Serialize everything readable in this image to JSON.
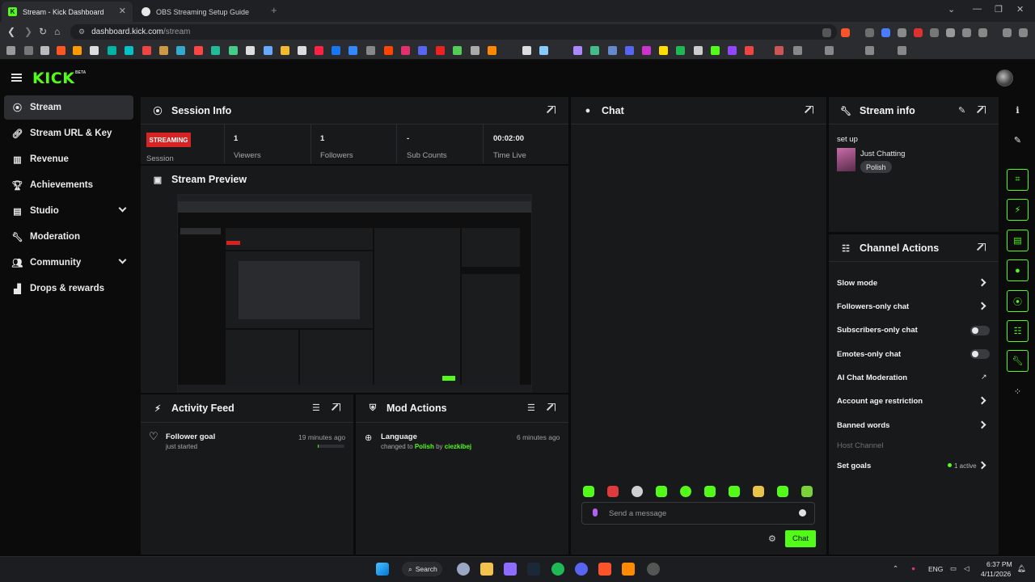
{
  "browser": {
    "tabs": [
      {
        "label": "Stream - Kick Dashboard",
        "active": true
      },
      {
        "label": "OBS Streaming Setup Guide",
        "active": false
      }
    ],
    "url_host": "dashboard.kick.com",
    "url_path": "/stream"
  },
  "app": {
    "logo": "KICK",
    "beta": "BETA"
  },
  "sidebar": {
    "items": [
      {
        "label": "Stream",
        "icon": "live-icon"
      },
      {
        "label": "Stream URL & Key",
        "icon": "link-icon"
      },
      {
        "label": "Revenue",
        "icon": "chart-icon"
      },
      {
        "label": "Achievements",
        "icon": "trophy-icon"
      },
      {
        "label": "Studio",
        "icon": "studio-icon"
      },
      {
        "label": "Moderation",
        "icon": "wrench-icon"
      },
      {
        "label": "Community",
        "icon": "people-icon"
      },
      {
        "label": "Drops & rewards",
        "icon": "gift-icon"
      }
    ]
  },
  "session": {
    "title": "Session Info",
    "status": "STREAMING",
    "status_label": "Session",
    "stats": [
      {
        "value": "1",
        "label": "Viewers"
      },
      {
        "value": "1",
        "label": "Followers"
      },
      {
        "value": "-",
        "label": "Sub Counts"
      },
      {
        "value": "00:02:00",
        "label": "Time Live"
      }
    ]
  },
  "preview": {
    "title": "Stream Preview"
  },
  "activity": {
    "title": "Activity Feed",
    "item_title": "Follower goal",
    "item_sub": "just started",
    "item_time": "19 minutes ago",
    "progress": 0.02
  },
  "mod_actions": {
    "title": "Mod Actions",
    "item_title": "Language",
    "item_prefix": "changed to",
    "item_value": "Polish",
    "item_by": "by",
    "item_user": "ciezkibej",
    "item_time": "6 minutes ago"
  },
  "chat": {
    "title": "Chat",
    "placeholder": "Send a message",
    "send_label": "Chat"
  },
  "stream_info": {
    "title": "Stream info",
    "stream_title": "set up",
    "category": "Just Chatting",
    "tag": "Polish"
  },
  "channel_actions": {
    "title": "Channel Actions",
    "items": [
      {
        "label": "Slow mode",
        "control": "chevron"
      },
      {
        "label": "Followers-only chat",
        "control": "chevron"
      },
      {
        "label": "Subscribers-only chat",
        "control": "toggle"
      },
      {
        "label": "Emotes-only chat",
        "control": "toggle"
      },
      {
        "label": "AI Chat Moderation",
        "control": "external"
      },
      {
        "label": "Account age restriction",
        "control": "chevron"
      },
      {
        "label": "Banned words",
        "control": "chevron"
      },
      {
        "label": "Host Channel",
        "control": "disabled"
      },
      {
        "label": "Set goals",
        "control": "chevron"
      }
    ],
    "goals_status": "1 active"
  },
  "taskbar": {
    "search": "Search",
    "lang": "ENG",
    "time": "6:37 PM",
    "date": "4/11/2026"
  },
  "colors": {
    "accent": "#53fc18",
    "live": "#d62323",
    "panel": "#18191b",
    "background": "#0b0b0c"
  }
}
